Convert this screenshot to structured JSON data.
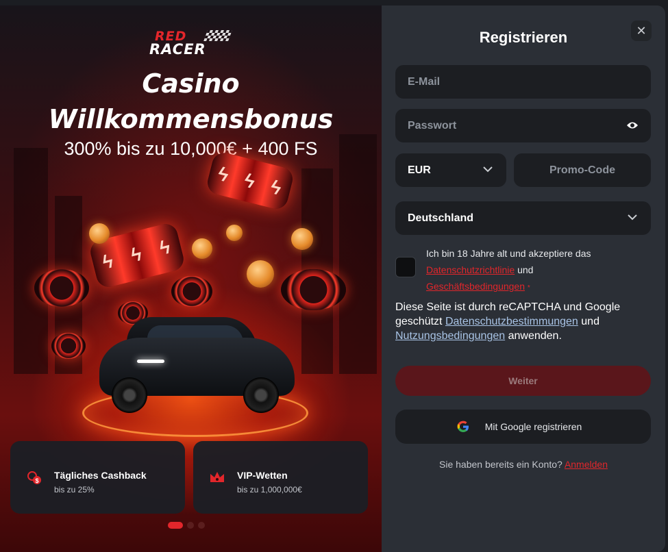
{
  "brand": {
    "logo_line1": "RED",
    "logo_line2": "RACER"
  },
  "promo": {
    "title_line1": "Casino",
    "title_line2": "Willkommensbonus",
    "subtitle": "300% bis zu 10,000€ + 400 FS",
    "features": [
      {
        "icon": "cashback-icon",
        "title": "Tägliches Cashback",
        "subtitle": "bis zu 25%"
      },
      {
        "icon": "crown-icon",
        "title": "VIP-Wetten",
        "subtitle": "bis zu 1,000,000€"
      }
    ],
    "carousel": {
      "total": 3,
      "active": 1
    }
  },
  "form": {
    "title": "Registrieren",
    "close_label": "✕",
    "email_placeholder": "E-Mail",
    "password_placeholder": "Passwort",
    "currency": "EUR",
    "promo_placeholder": "Promo-Code",
    "country": "Deutschland",
    "terms": {
      "text1": "Ich bin 18 Jahre alt und akzeptiere das",
      "privacy_link": "Datenschutzrichtlinie",
      "and": "und",
      "terms_link": "Geschäftsbedingungen",
      "required_mark": "*"
    },
    "captcha": {
      "text1": "Diese Seite ist durch reCAPTCHA und Google geschützt",
      "privacy_link": "Datenschutzbestimmungen",
      "and": "und",
      "terms_link": "Nutzungsbedingungen",
      "text2": "anwenden."
    },
    "next_label": "Weiter",
    "google_label": "Mit Google registrieren",
    "login_prompt": "Sie haben bereits ein Konto?",
    "login_link": "Anmelden"
  },
  "colors": {
    "accent": "#e2262b",
    "panel": "#2b2f36",
    "field": "#1c1e22"
  }
}
